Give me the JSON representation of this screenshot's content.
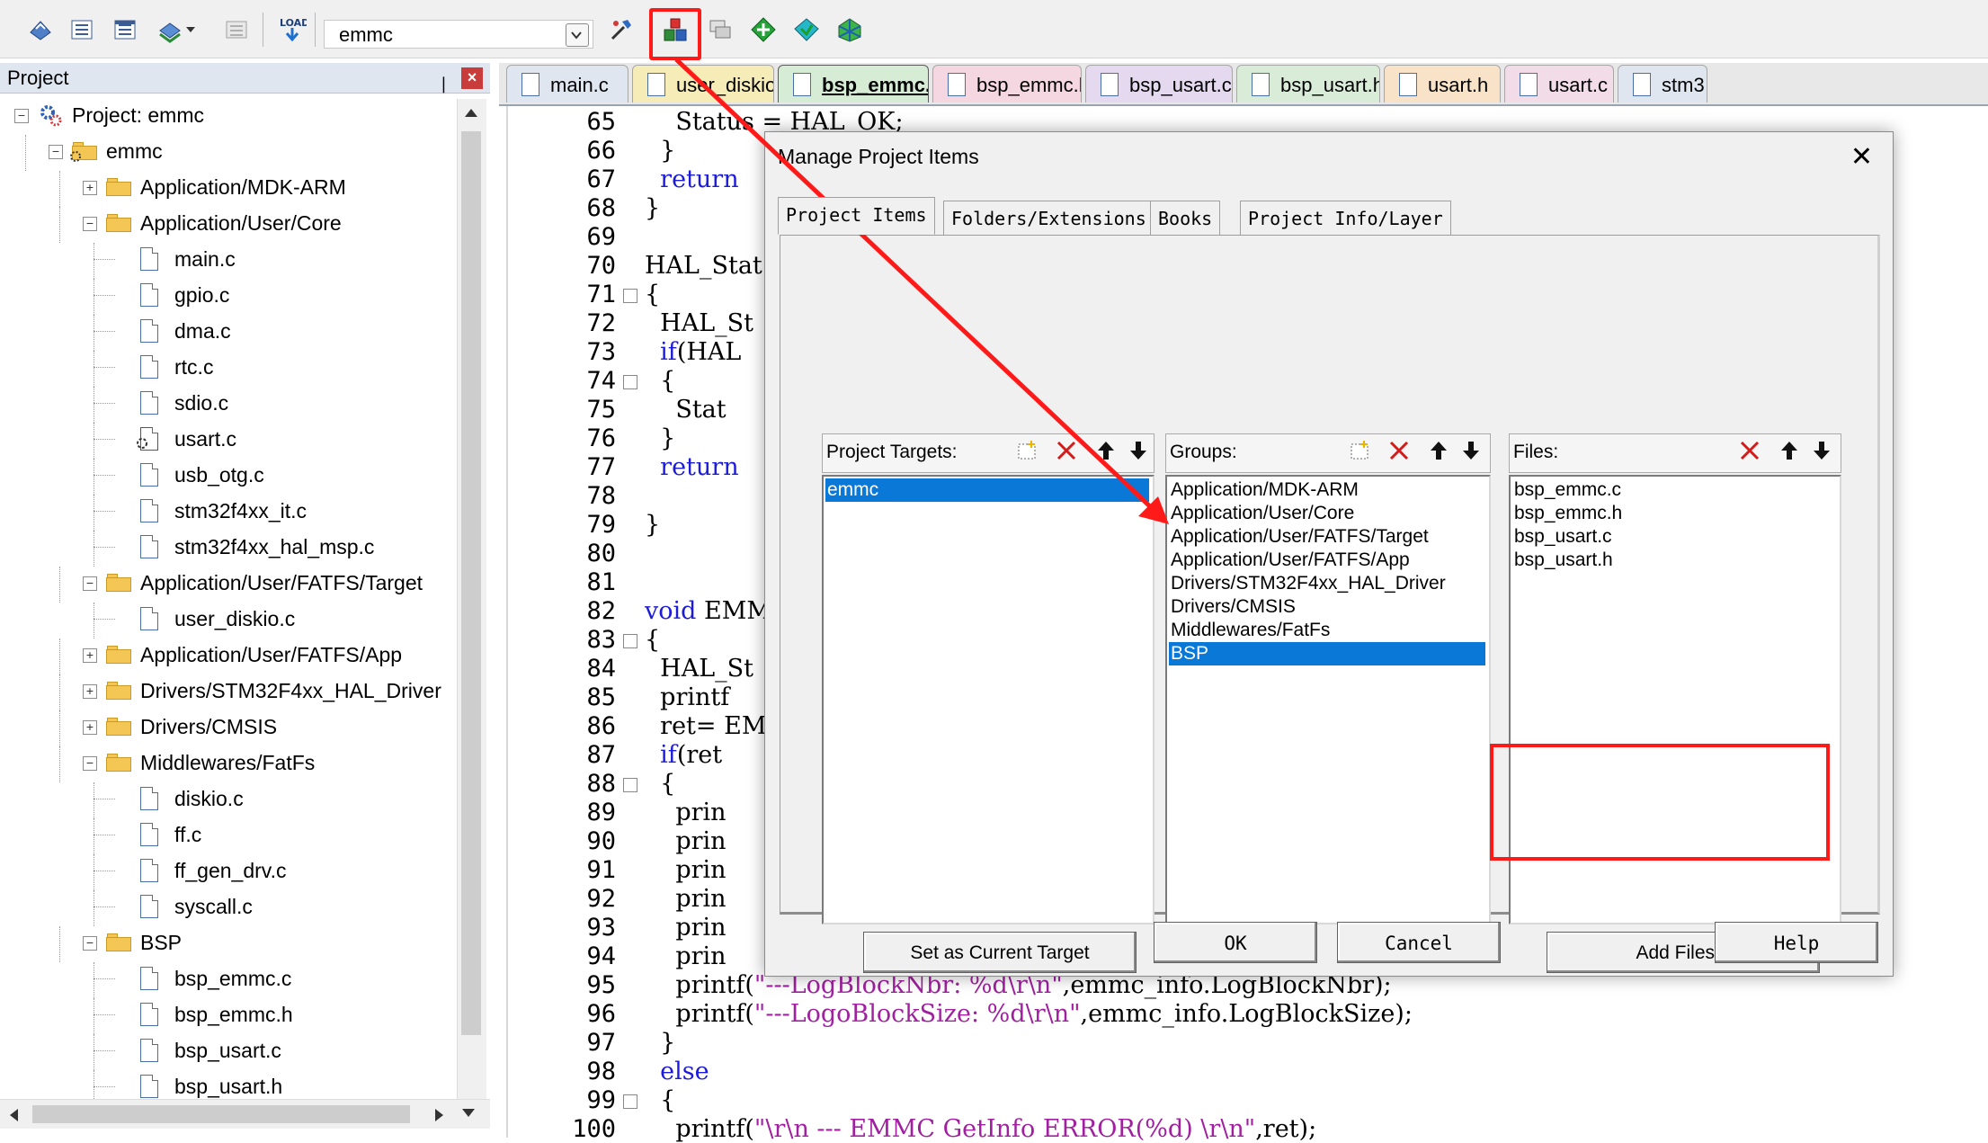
{
  "toolbar": {
    "target_name": "emmc"
  },
  "project_panel": {
    "title": "Project",
    "pin": "❘",
    "close": "×",
    "tree": [
      {
        "label": "Project: emmc",
        "kind": "project"
      },
      {
        "label": "emmc",
        "kind": "target"
      },
      {
        "label": "Application/MDK-ARM",
        "kind": "group",
        "expanded": false
      },
      {
        "label": "Application/User/Core",
        "kind": "group",
        "expanded": true
      },
      {
        "label": "main.c",
        "kind": "file"
      },
      {
        "label": "gpio.c",
        "kind": "file"
      },
      {
        "label": "dma.c",
        "kind": "file"
      },
      {
        "label": "rtc.c",
        "kind": "file"
      },
      {
        "label": "sdio.c",
        "kind": "file"
      },
      {
        "label": "usart.c",
        "kind": "file"
      },
      {
        "label": "usb_otg.c",
        "kind": "file"
      },
      {
        "label": "stm32f4xx_it.c",
        "kind": "file"
      },
      {
        "label": "stm32f4xx_hal_msp.c",
        "kind": "file"
      },
      {
        "label": "Application/User/FATFS/Target",
        "kind": "group",
        "expanded": true
      },
      {
        "label": "user_diskio.c",
        "kind": "file"
      },
      {
        "label": "Application/User/FATFS/App",
        "kind": "group",
        "expanded": false
      },
      {
        "label": "Drivers/STM32F4xx_HAL_Driver",
        "kind": "group",
        "expanded": false
      },
      {
        "label": "Drivers/CMSIS",
        "kind": "group",
        "expanded": false
      },
      {
        "label": "Middlewares/FatFs",
        "kind": "group",
        "expanded": true
      },
      {
        "label": "diskio.c",
        "kind": "file"
      },
      {
        "label": "ff.c",
        "kind": "file"
      },
      {
        "label": "ff_gen_drv.c",
        "kind": "file"
      },
      {
        "label": "syscall.c",
        "kind": "file"
      },
      {
        "label": "BSP",
        "kind": "group",
        "expanded": true
      },
      {
        "label": "bsp_emmc.c",
        "kind": "file"
      },
      {
        "label": "bsp_emmc.h",
        "kind": "file"
      },
      {
        "label": "bsp_usart.c",
        "kind": "file"
      },
      {
        "label": "bsp_usart.h",
        "kind": "file"
      }
    ]
  },
  "editor": {
    "tabs": [
      {
        "label": "main.c",
        "color": "#dfe6f0"
      },
      {
        "label": "user_diskio.c",
        "color": "#f5ecb8"
      },
      {
        "label": "bsp_emmc.c",
        "color": "#d7ecd5",
        "active": true
      },
      {
        "label": "bsp_emmc.h",
        "color": "#f4d7e0"
      },
      {
        "label": "bsp_usart.c",
        "color": "#e4d9ef"
      },
      {
        "label": "bsp_usart.h",
        "color": "#d9ecd8"
      },
      {
        "label": "usart.h",
        "color": "#f8e2c8"
      },
      {
        "label": "usart.c",
        "color": "#f1dce8"
      },
      {
        "label": "stm3",
        "color": "#dfe6f0"
      }
    ],
    "lines": [
      {
        "n": "65",
        "code": "    Status = HAL_OK;"
      },
      {
        "n": "66",
        "code": "  }"
      },
      {
        "n": "67",
        "code": "  return"
      },
      {
        "n": "68",
        "code": "}"
      },
      {
        "n": "69",
        "code": ""
      },
      {
        "n": "70",
        "code": "HAL_Stat"
      },
      {
        "n": "71",
        "code": "{"
      },
      {
        "n": "72",
        "code": "  HAL_St"
      },
      {
        "n": "73",
        "code": "  if(HAL"
      },
      {
        "n": "74",
        "code": "  {"
      },
      {
        "n": "75",
        "code": "    Stat"
      },
      {
        "n": "76",
        "code": "  }"
      },
      {
        "n": "77",
        "code": "  return"
      },
      {
        "n": "78",
        "code": ""
      },
      {
        "n": "79",
        "code": "}"
      },
      {
        "n": "80",
        "code": ""
      },
      {
        "n": "81",
        "code": ""
      },
      {
        "n": "82",
        "code": "void EMM"
      },
      {
        "n": "83",
        "code": "{"
      },
      {
        "n": "84",
        "code": "  HAL_St"
      },
      {
        "n": "85",
        "code": "  printf"
      },
      {
        "n": "86",
        "code": "  ret= EM"
      },
      {
        "n": "87",
        "code": "  if(ret"
      },
      {
        "n": "88",
        "code": "  {"
      },
      {
        "n": "89",
        "code": "    prin"
      },
      {
        "n": "90",
        "code": "    prin"
      },
      {
        "n": "91",
        "code": "    prin"
      },
      {
        "n": "92",
        "code": "    prin"
      },
      {
        "n": "93",
        "code": "    prin"
      },
      {
        "n": "94",
        "code": "    prin"
      },
      {
        "n": "95",
        "code": "    printf(\"---LogBlockNbr: %d\\r\\n\",emmc_info.LogBlockNbr);"
      },
      {
        "n": "96",
        "code": "    printf(\"---LogoBlockSize: %d\\r\\n\",emmc_info.LogBlockSize);"
      },
      {
        "n": "97",
        "code": "  }"
      },
      {
        "n": "98",
        "code": "  else"
      },
      {
        "n": "99",
        "code": "  {"
      },
      {
        "n": "100",
        "code": "    printf(\"\\r\\n --- EMMC GetInfo ERROR(%d) \\r\\n\",ret);"
      }
    ]
  },
  "dialog": {
    "title": "Manage Project Items",
    "close": "✕",
    "tabs": [
      "Project Items",
      "Folders/Extensions",
      "Books",
      "Project Info/Layer"
    ],
    "targets_label": "Project Targets:",
    "targets": [
      "emmc"
    ],
    "groups_label": "Groups:",
    "groups": [
      "Application/MDK-ARM",
      "Application/User/Core",
      "Application/User/FATFS/Target",
      "Application/User/FATFS/App",
      "Drivers/STM32F4xx_HAL_Driver",
      "Drivers/CMSIS",
      "Middlewares/FatFs",
      "BSP"
    ],
    "files_label": "Files:",
    "files": [
      "bsp_emmc.c",
      "bsp_emmc.h",
      "bsp_usart.c",
      "bsp_usart.h"
    ],
    "set_target_button": "Set as Current Target",
    "add_files_button": "Add Files...",
    "ok_button": "OK",
    "cancel_button": "Cancel",
    "help_button": "Help"
  },
  "colors": {
    "selection": "#0a78d7",
    "annotation_red": "#ff1a1a",
    "keyword": "#1b1bd9",
    "string": "#a020a0"
  }
}
